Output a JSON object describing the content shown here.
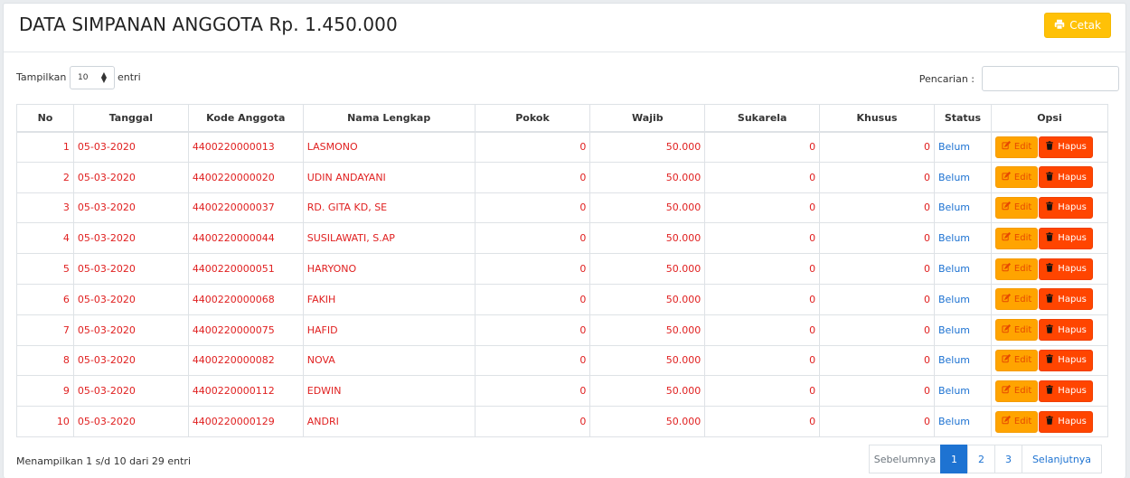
{
  "header": {
    "title": "DATA SIMPANAN ANGGOTA Rp. 1.450.000",
    "print_label": "Cetak",
    "print_icon": "printer-icon"
  },
  "toolbar": {
    "length_label": "Tampilkan",
    "length_value": "10",
    "length_suffix": "entri",
    "search_label": "Pencarian :",
    "search_value": ""
  },
  "table": {
    "columns": [
      "No",
      "Tanggal",
      "Kode Anggota",
      "Nama Lengkap",
      "Pokok",
      "Wajib",
      "Sukarela",
      "Khusus",
      "Status",
      "Opsi"
    ],
    "edit_label": "Edit",
    "delete_label": "Hapus",
    "rows": [
      {
        "no": "1",
        "tanggal": "05-03-2020",
        "kode": "4400220000013",
        "nama": "LASMONO",
        "pokok": "0",
        "wajib": "50.000",
        "sukarela": "0",
        "khusus": "0",
        "status": "Belum"
      },
      {
        "no": "2",
        "tanggal": "05-03-2020",
        "kode": "4400220000020",
        "nama": "UDIN ANDAYANI",
        "pokok": "0",
        "wajib": "50.000",
        "sukarela": "0",
        "khusus": "0",
        "status": "Belum"
      },
      {
        "no": "3",
        "tanggal": "05-03-2020",
        "kode": "4400220000037",
        "nama": "RD. GITA KD, SE",
        "pokok": "0",
        "wajib": "50.000",
        "sukarela": "0",
        "khusus": "0",
        "status": "Belum"
      },
      {
        "no": "4",
        "tanggal": "05-03-2020",
        "kode": "4400220000044",
        "nama": "SUSILAWATI, S.AP",
        "pokok": "0",
        "wajib": "50.000",
        "sukarela": "0",
        "khusus": "0",
        "status": "Belum"
      },
      {
        "no": "5",
        "tanggal": "05-03-2020",
        "kode": "4400220000051",
        "nama": "HARYONO",
        "pokok": "0",
        "wajib": "50.000",
        "sukarela": "0",
        "khusus": "0",
        "status": "Belum"
      },
      {
        "no": "6",
        "tanggal": "05-03-2020",
        "kode": "4400220000068",
        "nama": "FAKIH",
        "pokok": "0",
        "wajib": "50.000",
        "sukarela": "0",
        "khusus": "0",
        "status": "Belum"
      },
      {
        "no": "7",
        "tanggal": "05-03-2020",
        "kode": "4400220000075",
        "nama": "HAFID",
        "pokok": "0",
        "wajib": "50.000",
        "sukarela": "0",
        "khusus": "0",
        "status": "Belum"
      },
      {
        "no": "8",
        "tanggal": "05-03-2020",
        "kode": "4400220000082",
        "nama": "NOVA",
        "pokok": "0",
        "wajib": "50.000",
        "sukarela": "0",
        "khusus": "0",
        "status": "Belum"
      },
      {
        "no": "9",
        "tanggal": "05-03-2020",
        "kode": "4400220000112",
        "nama": "EDWIN",
        "pokok": "0",
        "wajib": "50.000",
        "sukarela": "0",
        "khusus": "0",
        "status": "Belum"
      },
      {
        "no": "10",
        "tanggal": "05-03-2020",
        "kode": "4400220000129",
        "nama": "ANDRI",
        "pokok": "0",
        "wajib": "50.000",
        "sukarela": "0",
        "khusus": "0",
        "status": "Belum"
      }
    ]
  },
  "footer": {
    "info": "Menampilkan 1 s/d 10 dari 29 entri",
    "prev_label": "Sebelumnya",
    "pages": [
      "1",
      "2",
      "3"
    ],
    "active_page": "1",
    "next_label": "Selanjutnya"
  },
  "colors": {
    "accent": "#1e73d2",
    "cell_text": "#e02020",
    "print_button": "#ffc107",
    "edit_button": "#ffa400",
    "delete_button": "#ff4500"
  }
}
